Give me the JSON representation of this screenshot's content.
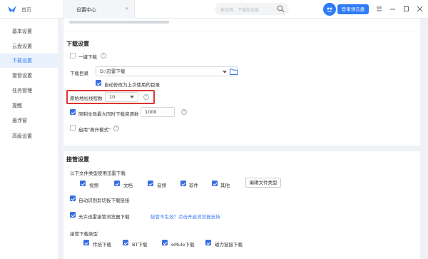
{
  "topbar": {
    "home_label": "首页",
    "tab_label": "设置中心",
    "tab_close": "×",
    "search_placeholder": "搜全网、下载和云盘",
    "login_label": "登录领云盘"
  },
  "sidebar": {
    "items": [
      {
        "label": "基本设置",
        "active": false
      },
      {
        "label": "云盘设置",
        "active": false
      },
      {
        "label": "下载设置",
        "active": true
      },
      {
        "label": "接管设置",
        "active": false
      },
      {
        "label": "任务管理",
        "active": false
      },
      {
        "label": "提醒",
        "active": false
      },
      {
        "label": "悬浮窗",
        "active": false
      },
      {
        "label": "高级设置",
        "active": false
      }
    ]
  },
  "download": {
    "title": "下载设置",
    "one_click": {
      "label": "一键下载",
      "checked": false
    },
    "dir_label": "下载目录",
    "dir_value": "D:\\迅雷下载",
    "auto_modify": {
      "label": "自动修改为上次使用的目录",
      "checked": true
    },
    "threads_label": "原始地址线程数",
    "threads_value": "10",
    "limit_tasks": {
      "label": "限制全局最大同时下载资源数",
      "checked": true
    },
    "limit_value": "1000",
    "offline_mode": {
      "label": "启用\"离开模式\"",
      "checked": false
    }
  },
  "takeover": {
    "title": "接管设置",
    "types_label": "以下文件类型使用迅雷下载",
    "types": [
      {
        "label": "视频",
        "checked": true
      },
      {
        "label": "文档",
        "checked": true
      },
      {
        "label": "音频",
        "checked": true
      },
      {
        "label": "软件",
        "checked": true
      },
      {
        "label": "其他",
        "checked": true
      }
    ],
    "edit_types_button": "编辑文件类型",
    "clipboard": {
      "label": "自动识别剪切板下载链接",
      "checked": true
    },
    "browser": {
      "label": "允许迅雷接管浏览器下载",
      "checked": true
    },
    "browser_link": "接管不生效？点击开启浏览器支持",
    "dl_types_label": "接管下载类型",
    "dl_types": [
      {
        "label": "传统下载",
        "checked": true
      },
      {
        "label": "BT下载",
        "checked": true
      },
      {
        "label": "eMule下载",
        "checked": true
      },
      {
        "label": "磁力链接下载",
        "checked": true
      }
    ]
  },
  "colors": {
    "accent": "#2e7cf6",
    "highlight": "#e0332f",
    "link": "#3a7bf0"
  }
}
